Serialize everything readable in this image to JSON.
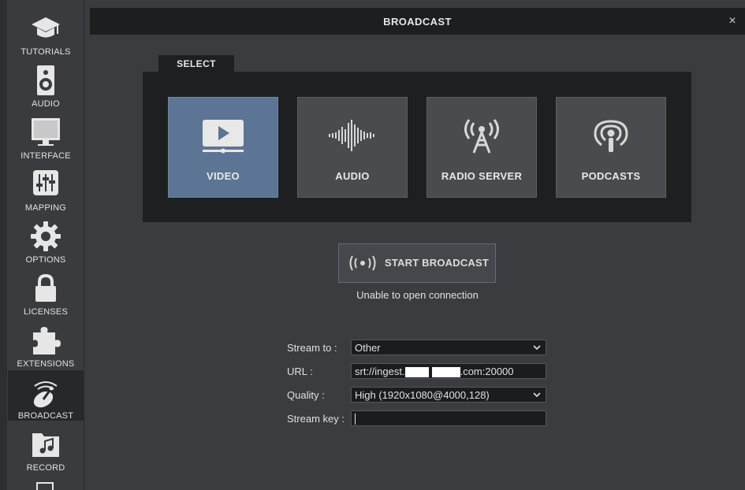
{
  "sidebar": {
    "items": [
      {
        "label": "TUTORIALS",
        "icon": "graduation-cap-icon"
      },
      {
        "label": "AUDIO",
        "icon": "speaker-icon"
      },
      {
        "label": "INTERFACE",
        "icon": "monitor-icon"
      },
      {
        "label": "MAPPING",
        "icon": "sliders-icon"
      },
      {
        "label": "OPTIONS",
        "icon": "gear-icon"
      },
      {
        "label": "LICENSES",
        "icon": "lock-icon"
      },
      {
        "label": "EXTENSIONS",
        "icon": "puzzle-icon"
      },
      {
        "label": "BROADCAST",
        "icon": "broadcast-dish-icon",
        "active": true
      },
      {
        "label": "RECORD",
        "icon": "music-folder-icon"
      }
    ]
  },
  "window": {
    "title": "BROADCAST",
    "close_symbol": "×"
  },
  "select": {
    "tab_label": "SELECT",
    "cards": [
      {
        "label": "VIDEO",
        "icon": "video-play-icon",
        "active": true
      },
      {
        "label": "AUDIO",
        "icon": "waveform-icon"
      },
      {
        "label": "RADIO SERVER",
        "icon": "radio-tower-icon"
      },
      {
        "label": "PODCASTS",
        "icon": "podcast-icon"
      }
    ]
  },
  "broadcast": {
    "start_label": "START BROADCAST",
    "status": "Unable to open connection"
  },
  "form": {
    "stream_to": {
      "label": "Stream to :",
      "value": "Other"
    },
    "url": {
      "label": "URL :",
      "value_prefix": "srt://ingest.",
      "value_suffix": ".com:20000"
    },
    "quality": {
      "label": "Quality :",
      "value": "High (1920x1080@4000,128)"
    },
    "stream_key": {
      "label": "Stream key :",
      "value": ""
    }
  },
  "colors": {
    "background": "#3b3c40",
    "panel": "#1e1f21",
    "accent_active": "#5d7594",
    "card": "#4a4b4f"
  }
}
